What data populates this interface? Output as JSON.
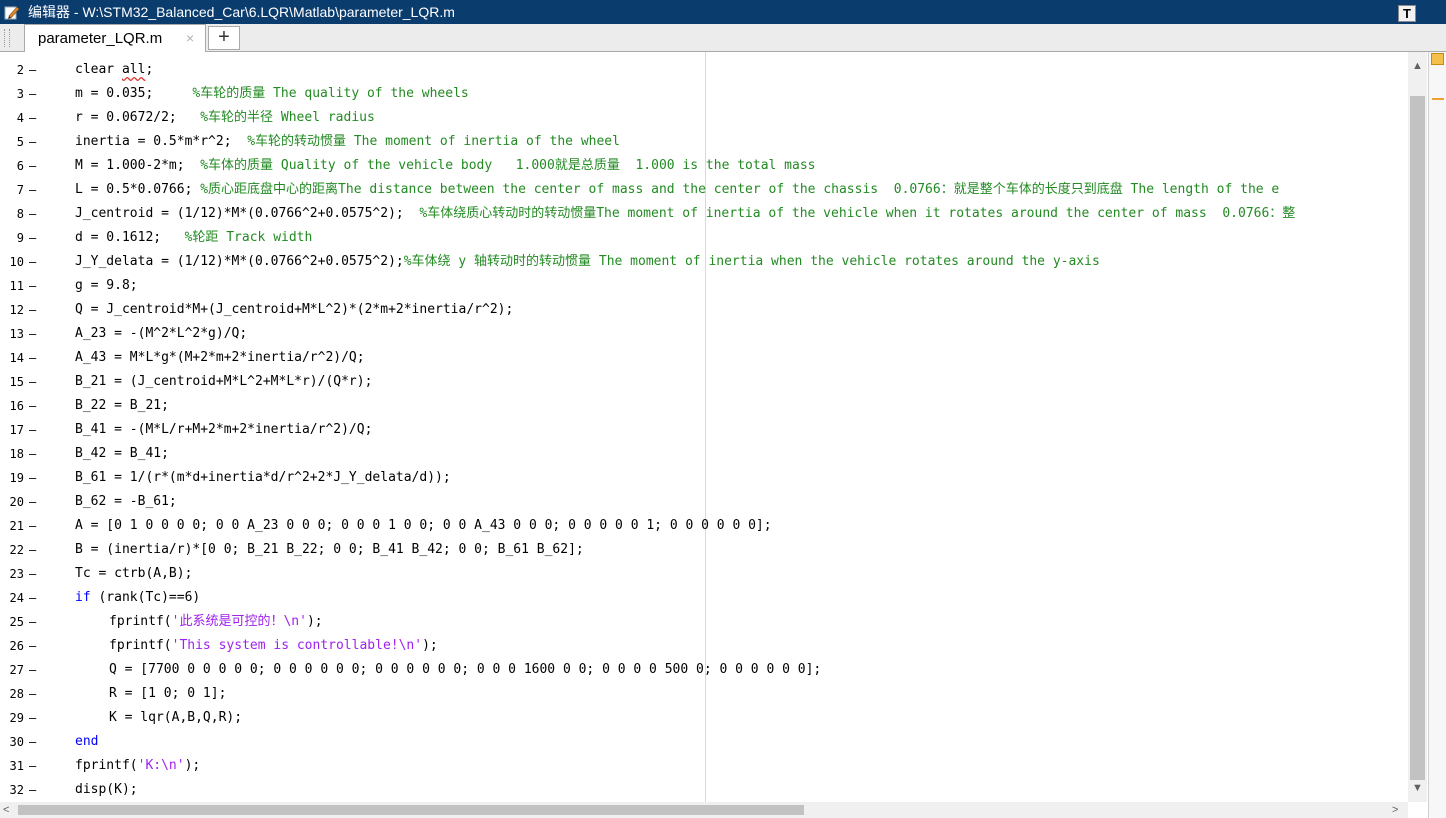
{
  "window": {
    "title": "编辑器 - W:\\STM32_Balanced_Car\\6.LQR\\Matlab\\parameter_LQR.m",
    "pin_button": "T"
  },
  "tabs": {
    "active_label": "parameter_LQR.m",
    "close_glyph": "×",
    "add_glyph": "+"
  },
  "editor": {
    "dash": "–",
    "lines": [
      {
        "n": "2",
        "indent": 0,
        "segs": [
          {
            "t": "clear ",
            "c": ""
          },
          {
            "t": "all",
            "c": "sq"
          },
          {
            "t": ";",
            "c": ""
          }
        ]
      },
      {
        "n": "3",
        "indent": 0,
        "segs": [
          {
            "t": "m = 0.035;     ",
            "c": ""
          },
          {
            "t": "%车轮的质量 The quality of the wheels",
            "c": "cm"
          }
        ]
      },
      {
        "n": "4",
        "indent": 0,
        "segs": [
          {
            "t": "r = 0.0672/2;   ",
            "c": ""
          },
          {
            "t": "%车轮的半径 Wheel radius",
            "c": "cm"
          }
        ]
      },
      {
        "n": "5",
        "indent": 0,
        "segs": [
          {
            "t": "inertia = 0.5*m*r^2;  ",
            "c": ""
          },
          {
            "t": "%车轮的转动惯量 The moment of inertia of the wheel",
            "c": "cm"
          }
        ]
      },
      {
        "n": "6",
        "indent": 0,
        "segs": [
          {
            "t": "M = 1.000-2*m;  ",
            "c": ""
          },
          {
            "t": "%车体的质量 Quality of the vehicle body   1.000就是总质量  1.000 is the total mass",
            "c": "cm"
          }
        ]
      },
      {
        "n": "7",
        "indent": 0,
        "segs": [
          {
            "t": "L = 0.5*0.0766; ",
            "c": ""
          },
          {
            "t": "%质心距底盘中心的距离The distance between the center of mass and the center of the chassis  0.0766：就是整个车体的长度只到底盘 The length of the e",
            "c": "cm"
          }
        ]
      },
      {
        "n": "8",
        "indent": 0,
        "segs": [
          {
            "t": "J_centroid = (1/12)*M*(0.0766^2+0.0575^2);  ",
            "c": ""
          },
          {
            "t": "%车体绕质心转动时的转动惯量The moment of inertia of the vehicle when it rotates around the center of mass  0.0766：整",
            "c": "cm"
          }
        ]
      },
      {
        "n": "9",
        "indent": 0,
        "segs": [
          {
            "t": "d = 0.1612;   ",
            "c": ""
          },
          {
            "t": "%轮距 Track width",
            "c": "cm"
          }
        ]
      },
      {
        "n": "10",
        "indent": 0,
        "segs": [
          {
            "t": "J_Y_delata = (1/12)*M*(0.0766^2+0.0575^2);",
            "c": ""
          },
          {
            "t": "%车体绕 y 轴转动时的转动惯量 The moment of inertia when the vehicle rotates around the y-axis",
            "c": "cm"
          }
        ]
      },
      {
        "n": "11",
        "indent": 0,
        "segs": [
          {
            "t": "g = 9.8;",
            "c": ""
          }
        ]
      },
      {
        "n": "12",
        "indent": 0,
        "segs": [
          {
            "t": "Q = J_centroid*M+(J_centroid+M*L^2)*(2*m+2*inertia/r^2);",
            "c": ""
          }
        ]
      },
      {
        "n": "13",
        "indent": 0,
        "segs": [
          {
            "t": "A_23 = -(M^2*L^2*g)/Q;",
            "c": ""
          }
        ]
      },
      {
        "n": "14",
        "indent": 0,
        "segs": [
          {
            "t": "A_43 = M*L*g*(M+2*m+2*inertia/r^2)/Q;",
            "c": ""
          }
        ]
      },
      {
        "n": "15",
        "indent": 0,
        "segs": [
          {
            "t": "B_21 = (J_centroid+M*L^2+M*L*r)/(Q*r);",
            "c": ""
          }
        ]
      },
      {
        "n": "16",
        "indent": 0,
        "segs": [
          {
            "t": "B_22 = B_21;",
            "c": ""
          }
        ]
      },
      {
        "n": "17",
        "indent": 0,
        "segs": [
          {
            "t": "B_41 = -(M*L/r+M+2*m+2*inertia/r^2)/Q;",
            "c": ""
          }
        ]
      },
      {
        "n": "18",
        "indent": 0,
        "segs": [
          {
            "t": "B_42 = B_41;",
            "c": ""
          }
        ]
      },
      {
        "n": "19",
        "indent": 0,
        "segs": [
          {
            "t": "B_61 = 1/(r*(m*d+inertia*d/r^2+2*J_Y_delata/d));",
            "c": ""
          }
        ]
      },
      {
        "n": "20",
        "indent": 0,
        "segs": [
          {
            "t": "B_62 = -B_61;",
            "c": ""
          }
        ]
      },
      {
        "n": "21",
        "indent": 0,
        "segs": [
          {
            "t": "A = [0 1 0 0 0 0; 0 0 A_23 0 0 0; 0 0 0 1 0 0; 0 0 A_43 0 0 0; 0 0 0 0 0 1; 0 0 0 0 0 0];",
            "c": ""
          }
        ]
      },
      {
        "n": "22",
        "indent": 0,
        "segs": [
          {
            "t": "B = (inertia/r)*[0 0; B_21 B_22; 0 0; B_41 B_42; 0 0; B_61 B_62];",
            "c": ""
          }
        ]
      },
      {
        "n": "23",
        "indent": 0,
        "segs": [
          {
            "t": "Tc = ctrb(A,B);",
            "c": ""
          }
        ]
      },
      {
        "n": "24",
        "indent": 0,
        "segs": [
          {
            "t": "if",
            "c": "kw"
          },
          {
            "t": " (rank(Tc)==6)",
            "c": ""
          }
        ]
      },
      {
        "n": "25",
        "indent": 1,
        "segs": [
          {
            "t": "fprintf(",
            "c": ""
          },
          {
            "t": "'此系统是可控的！\\n'",
            "c": "st"
          },
          {
            "t": ");",
            "c": ""
          }
        ]
      },
      {
        "n": "26",
        "indent": 1,
        "segs": [
          {
            "t": "fprintf(",
            "c": ""
          },
          {
            "t": "'This system is controllable!\\n'",
            "c": "st"
          },
          {
            "t": ");",
            "c": ""
          }
        ]
      },
      {
        "n": "27",
        "indent": 1,
        "segs": [
          {
            "t": "Q = [7700 0 0 0 0 0; 0 0 0 0 0 0; 0 0 0 0 0 0; 0 0 0 1600 0 0; 0 0 0 0 500 0; 0 0 0 0 0 0];",
            "c": ""
          }
        ]
      },
      {
        "n": "28",
        "indent": 1,
        "segs": [
          {
            "t": "R = [1 0; 0 1];",
            "c": ""
          }
        ]
      },
      {
        "n": "29",
        "indent": 1,
        "segs": [
          {
            "t": "K = lqr(A,B,Q,R);",
            "c": ""
          }
        ]
      },
      {
        "n": "30",
        "indent": 0,
        "segs": [
          {
            "t": "end",
            "c": "kw"
          }
        ]
      },
      {
        "n": "31",
        "indent": 0,
        "segs": [
          {
            "t": "fprintf(",
            "c": ""
          },
          {
            "t": "'K:\\n'",
            "c": "st"
          },
          {
            "t": ");",
            "c": ""
          }
        ]
      },
      {
        "n": "32",
        "indent": 0,
        "segs": [
          {
            "t": "disp(K);",
            "c": ""
          }
        ]
      }
    ]
  },
  "scroll": {
    "up": "▲",
    "down": "▼",
    "left": "<",
    "right": ">"
  },
  "icons": {
    "editor": "editor-pencil-icon",
    "close": "close-icon",
    "add": "plus-icon"
  },
  "colors": {
    "titlebar": "#0a3c6e",
    "keyword": "#0000ff",
    "comment": "#228b22",
    "string": "#a020f0"
  }
}
